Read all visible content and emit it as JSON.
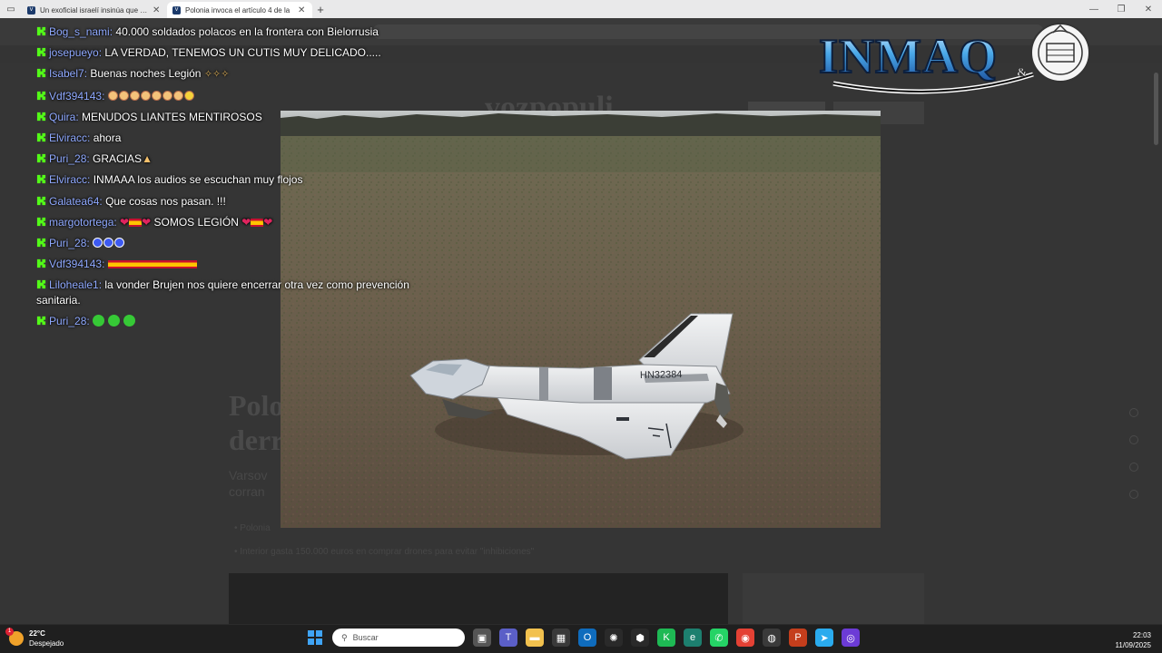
{
  "browser": {
    "tabs": [
      {
        "title": "Un exoficial israelí insinúa que Sá",
        "active": false
      },
      {
        "title": "Polonia invoca el artículo 4 de la",
        "active": true
      }
    ],
    "new_tab": "+"
  },
  "chat": {
    "messages": [
      {
        "user": "Bog_s_nami",
        "text": "40.000 soldados polacos en la frontera con Bielorrusia"
      },
      {
        "user": "josepueyo",
        "text": "LA VERDAD, TENEMOS UN CUTIS MUY DELICADO....."
      },
      {
        "user": "Isabel7",
        "text": "Buenas noches Legión"
      },
      {
        "user": "Vdf394143",
        "text": ""
      },
      {
        "user": "Quira",
        "text": "MENUDOS LIANTES MENTIROSOS"
      },
      {
        "user": "Elviracc",
        "text": "ahora"
      },
      {
        "user": "Puri_28",
        "text": "GRACIAS"
      },
      {
        "user": "Elviracc",
        "text": "INMAAA los audios se escuchan muy flojos"
      },
      {
        "user": "Galatea64",
        "text": "Que cosas nos pasan. !!!"
      },
      {
        "user": "margotortega",
        "text": "SOMOS LEGIÓN"
      },
      {
        "user": "Puri_28",
        "text": ""
      },
      {
        "user": "Vdf394143",
        "text": ""
      },
      {
        "user": "Liloheale1",
        "text": "la vonder Brujen nos quiere encerrar otra vez como prevención sanitaria."
      },
      {
        "user": "Puri_28",
        "text": ""
      }
    ]
  },
  "photo": {
    "registration": "HN32384"
  },
  "logo": {
    "text": "INMAQ",
    "ampersand": "&"
  },
  "taskbar": {
    "weather_temp": "22°C",
    "weather_desc": "Despejado",
    "weather_badge": "1",
    "search_placeholder": "Buscar",
    "time": "22:03",
    "date": "11/09/2025"
  }
}
